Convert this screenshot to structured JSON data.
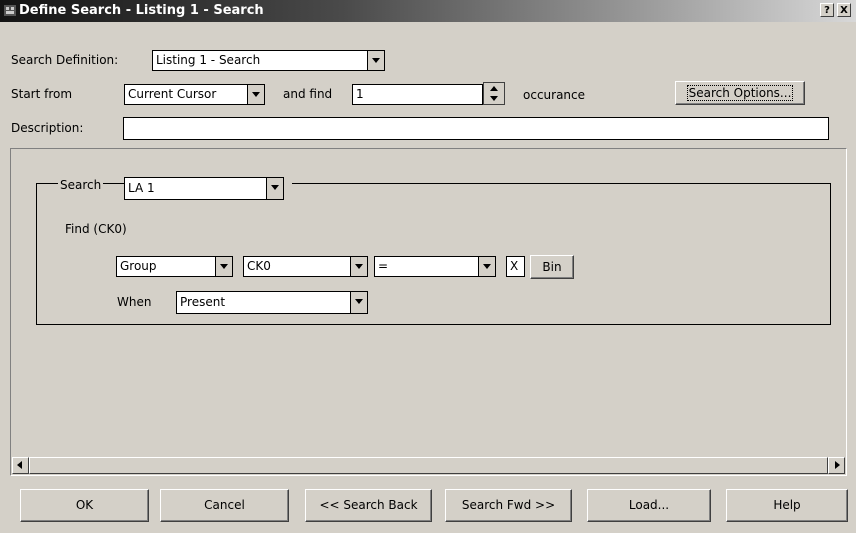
{
  "window": {
    "title": "Define Search - Listing 1 - Search",
    "help_button": "?",
    "close_button": "X"
  },
  "header": {
    "search_definition_label": "Search Definition:",
    "search_definition_value": "Listing 1 - Search",
    "start_from_label": "Start from",
    "start_from_value": "Current Cursor",
    "and_find_label": "and find",
    "find_count_value": "1",
    "occurance_label": "occurance",
    "search_options_button": "Search Options...",
    "description_label": "Description:",
    "description_value": ""
  },
  "search_group": {
    "label": "Search",
    "source_value": "LA 1",
    "find_label": "Find (CK0)",
    "group_value": "Group",
    "signal_value": "CK0",
    "operator_value": "=",
    "pattern_value": "X",
    "radix_button": "Bin",
    "when_label": "When",
    "when_value": "Present"
  },
  "footer": {
    "ok": "OK",
    "cancel": "Cancel",
    "search_back": "<< Search Back",
    "search_fwd": "Search Fwd >>",
    "load": "Load...",
    "help": "Help"
  }
}
